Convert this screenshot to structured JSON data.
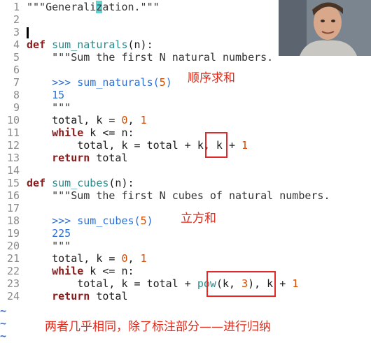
{
  "lines": [
    {
      "n": "1",
      "t": "\"\"\"Generalization.\"\"\""
    },
    {
      "n": "2",
      "t": ""
    },
    {
      "n": "3",
      "t": ""
    },
    {
      "n": "4",
      "t": "def sum_naturals(n):"
    },
    {
      "n": "5",
      "t": "    \"\"\"Sum the first N natural numbers."
    },
    {
      "n": "6",
      "t": ""
    },
    {
      "n": "7",
      "t": "    >>> sum_naturals(5)"
    },
    {
      "n": "8",
      "t": "    15"
    },
    {
      "n": "9",
      "t": "    \"\"\""
    },
    {
      "n": "10",
      "t": "    total, k = 0, 1"
    },
    {
      "n": "11",
      "t": "    while k <= n:"
    },
    {
      "n": "12",
      "t": "        total, k = total + k, k + 1"
    },
    {
      "n": "13",
      "t": "    return total"
    },
    {
      "n": "14",
      "t": ""
    },
    {
      "n": "15",
      "t": "def sum_cubes(n):"
    },
    {
      "n": "16",
      "t": "    \"\"\"Sum the first N cubes of natural numbers."
    },
    {
      "n": "17",
      "t": ""
    },
    {
      "n": "18",
      "t": "    >>> sum_cubes(5)"
    },
    {
      "n": "19",
      "t": "    225"
    },
    {
      "n": "20",
      "t": "    \"\"\""
    },
    {
      "n": "21",
      "t": "    total, k = 0, 1"
    },
    {
      "n": "22",
      "t": "    while k <= n:"
    },
    {
      "n": "23",
      "t": "        total, k = total + pow(k, 3), k + 1"
    },
    {
      "n": "24",
      "t": "    return total"
    }
  ],
  "tilde": "~",
  "annotations": {
    "sum_naturals": "顺序求和",
    "sum_cubes": "立方和",
    "bottom": "两者几乎相同，除了标注部分——进行归纳"
  },
  "colors": {
    "keyword": "#8b1a1a",
    "function": "#2a8a8a",
    "number": "#d14a00",
    "annotation": "#e02a1a",
    "box": "#e22828",
    "highlight": "#5fd3d3"
  }
}
